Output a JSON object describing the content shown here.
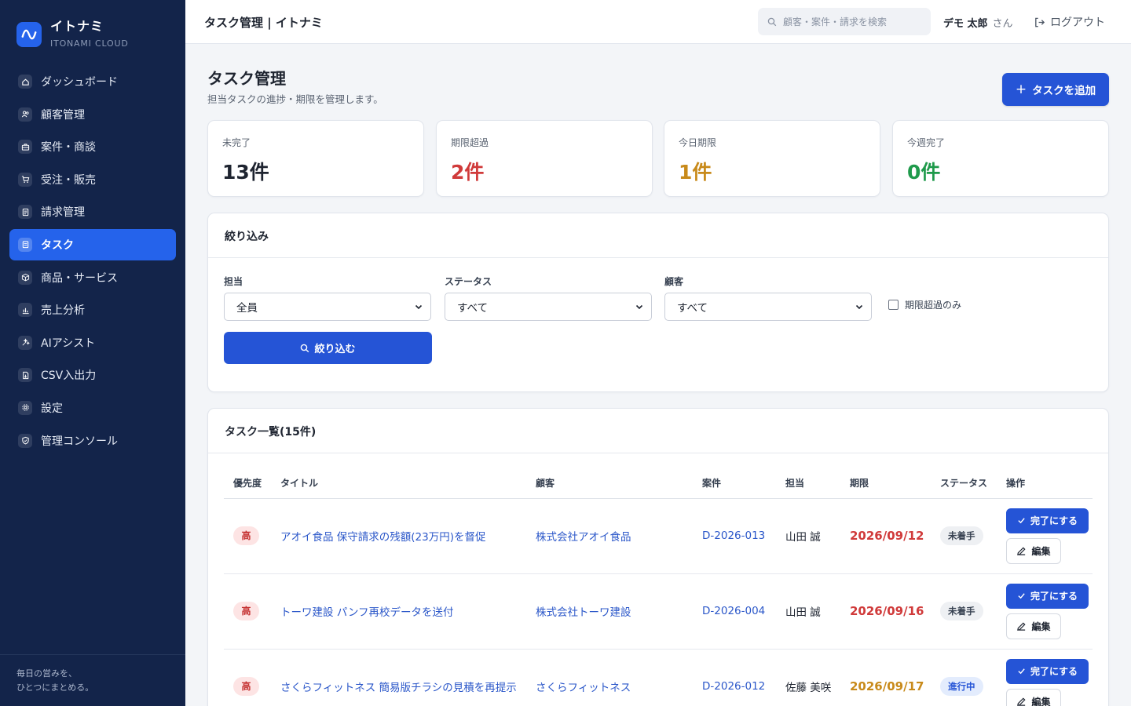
{
  "brand": {
    "name": "イトナミ",
    "sub": "ITONAMI CLOUD"
  },
  "sidebar": {
    "items": [
      {
        "label": "ダッシュボード",
        "icon": "home-icon"
      },
      {
        "label": "顧客管理",
        "icon": "users-icon"
      },
      {
        "label": "案件・商談",
        "icon": "briefcase-icon"
      },
      {
        "label": "受注・販売",
        "icon": "cart-icon"
      },
      {
        "label": "請求管理",
        "icon": "invoice-icon"
      },
      {
        "label": "タスク",
        "icon": "clipboard-icon",
        "active": true
      },
      {
        "label": "商品・サービス",
        "icon": "box-icon"
      },
      {
        "label": "売上分析",
        "icon": "bar-chart-icon"
      },
      {
        "label": "AIアシスト",
        "icon": "sparkle-icon"
      },
      {
        "label": "CSV入出力",
        "icon": "file-csv-icon"
      },
      {
        "label": "設定",
        "icon": "gear-icon"
      },
      {
        "label": "管理コンソール",
        "icon": "shield-icon"
      }
    ],
    "footer_line1": "毎日の営みを、",
    "footer_line2": "ひとつにまとめる。"
  },
  "header": {
    "title": "タスク管理 | イトナミ",
    "search_placeholder": "顧客・案件・請求を検索",
    "user_name": "デモ 太郎",
    "user_suffix": "さん",
    "logout": "ログアウト"
  },
  "page": {
    "title": "タスク管理",
    "subtitle": "担当タスクの進捗・期限を管理します。",
    "add_button": "タスクを追加"
  },
  "stats": [
    {
      "label": "未完了",
      "value": "13件",
      "color": "#1e2430"
    },
    {
      "label": "期限超過",
      "value": "2件",
      "color": "#d03a3a"
    },
    {
      "label": "今日期限",
      "value": "1件",
      "color": "#c88a1a"
    },
    {
      "label": "今週完了",
      "value": "0件",
      "color": "#1f9a4b"
    }
  ],
  "filter": {
    "title": "絞り込み",
    "assignee_label": "担当",
    "assignee_value": "全員",
    "status_label": "ステータス",
    "status_value": "すべて",
    "customer_label": "顧客",
    "customer_value": "すべて",
    "overdue_only": "期限超過のみ",
    "button": "絞り込む"
  },
  "tasks": {
    "title": "タスク一覧(15件)",
    "columns": [
      "優先度",
      "タイトル",
      "顧客",
      "案件",
      "担当",
      "期限",
      "ステータス",
      "操作"
    ],
    "done_label": "完了にする",
    "edit_label": "編集",
    "rows": [
      {
        "priority": "高",
        "title": "アオイ食品 保守請求の残額(23万円)を督促",
        "customer": "株式会社アオイ食品",
        "deal": "D-2026-013",
        "assignee": "山田 誠",
        "due": "2026/09/12",
        "due_color": "#d03a3a",
        "status": "未着手",
        "status_bg": "#eef0f3",
        "status_color": "#374151"
      },
      {
        "priority": "高",
        "title": "トーワ建設 パンフ再校データを送付",
        "customer": "株式会社トーワ建設",
        "deal": "D-2026-004",
        "assignee": "山田 誠",
        "due": "2026/09/16",
        "due_color": "#d03a3a",
        "status": "未着手",
        "status_bg": "#eef0f3",
        "status_color": "#374151"
      },
      {
        "priority": "高",
        "title": "さくらフィットネス 簡易版チラシの見積を再提示",
        "customer": "さくらフィットネス",
        "deal": "D-2026-012",
        "assignee": "佐藤 美咲",
        "due": "2026/09/17",
        "due_color": "#c88a1a",
        "status": "進行中",
        "status_bg": "#e3ecfd",
        "status_color": "#2554d6"
      }
    ]
  }
}
